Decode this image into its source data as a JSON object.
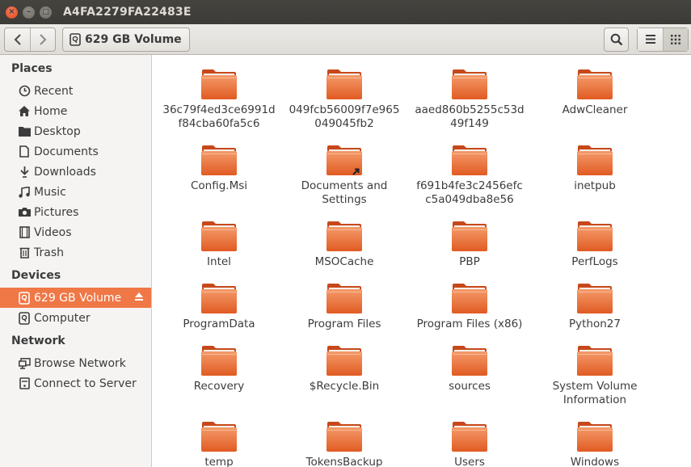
{
  "window": {
    "title": "A4FA2279FA22483E",
    "close_glyph": "×",
    "minimize_glyph": "–",
    "maximize_glyph": "□"
  },
  "toolbar": {
    "path_label": "629 GB Volume"
  },
  "sidebar": {
    "places_title": "Places",
    "places": [
      {
        "label": "Recent",
        "icon": "clock-icon"
      },
      {
        "label": "Home",
        "icon": "home-icon"
      },
      {
        "label": "Desktop",
        "icon": "folder-icon"
      },
      {
        "label": "Documents",
        "icon": "document-icon"
      },
      {
        "label": "Downloads",
        "icon": "download-icon"
      },
      {
        "label": "Music",
        "icon": "music-icon"
      },
      {
        "label": "Pictures",
        "icon": "camera-icon"
      },
      {
        "label": "Videos",
        "icon": "film-icon"
      },
      {
        "label": "Trash",
        "icon": "trash-icon"
      }
    ],
    "devices_title": "Devices",
    "devices": [
      {
        "label": "629 GB Volume",
        "icon": "drive-icon",
        "selected": true
      },
      {
        "label": "Computer",
        "icon": "computer-icon"
      }
    ],
    "network_title": "Network",
    "network": [
      {
        "label": "Browse Network",
        "icon": "network-icon"
      },
      {
        "label": "Connect to Server",
        "icon": "server-icon"
      }
    ]
  },
  "files": [
    {
      "name": "36c79f4ed3ce6991df84cba60fa5c6",
      "lines": [
        "36c79f4ed3ce6991d",
        "f84cba60fa5c6"
      ]
    },
    {
      "name": "049fcb56009f7e965049045fb2",
      "lines": [
        "049fcb56009f7e965",
        "049045fb2"
      ]
    },
    {
      "name": "aaed860b5255c53d49f149",
      "lines": [
        "aaed860b5255c53d",
        "49f149"
      ]
    },
    {
      "name": "AdwCleaner",
      "lines": [
        "AdwCleaner"
      ]
    },
    {
      "name": "Config.Msi",
      "lines": [
        "Config.Msi"
      ]
    },
    {
      "name": "Documents and Settings",
      "lines": [
        "Documents and",
        "Settings"
      ],
      "link": true
    },
    {
      "name": "f691b4fe3c2456efcc5a049dba8e56",
      "lines": [
        "f691b4fe3c2456efc",
        "c5a049dba8e56"
      ]
    },
    {
      "name": "inetpub",
      "lines": [
        "inetpub"
      ]
    },
    {
      "name": "Intel",
      "lines": [
        "Intel"
      ]
    },
    {
      "name": "MSOCache",
      "lines": [
        "MSOCache"
      ]
    },
    {
      "name": "PBP",
      "lines": [
        "PBP"
      ]
    },
    {
      "name": "PerfLogs",
      "lines": [
        "PerfLogs"
      ]
    },
    {
      "name": "ProgramData",
      "lines": [
        "ProgramData"
      ]
    },
    {
      "name": "Program Files",
      "lines": [
        "Program Files"
      ]
    },
    {
      "name": "Program Files (x86)",
      "lines": [
        "Program Files (x86)"
      ]
    },
    {
      "name": "Python27",
      "lines": [
        "Python27"
      ]
    },
    {
      "name": "Recovery",
      "lines": [
        "Recovery"
      ]
    },
    {
      "name": "$Recycle.Bin",
      "lines": [
        "$Recycle.Bin"
      ]
    },
    {
      "name": "sources",
      "lines": [
        "sources"
      ]
    },
    {
      "name": "System Volume Information",
      "lines": [
        "System Volume",
        "Information"
      ]
    },
    {
      "name": "temp",
      "lines": [
        "temp"
      ]
    },
    {
      "name": "TokensBackup",
      "lines": [
        "TokensBackup"
      ]
    },
    {
      "name": "Users",
      "lines": [
        "Users"
      ]
    },
    {
      "name": "Windows",
      "lines": [
        "Windows"
      ]
    }
  ],
  "colors": {
    "accent": "#f07746",
    "folder_top": "#f49a6a",
    "folder_bottom": "#e05b22"
  }
}
